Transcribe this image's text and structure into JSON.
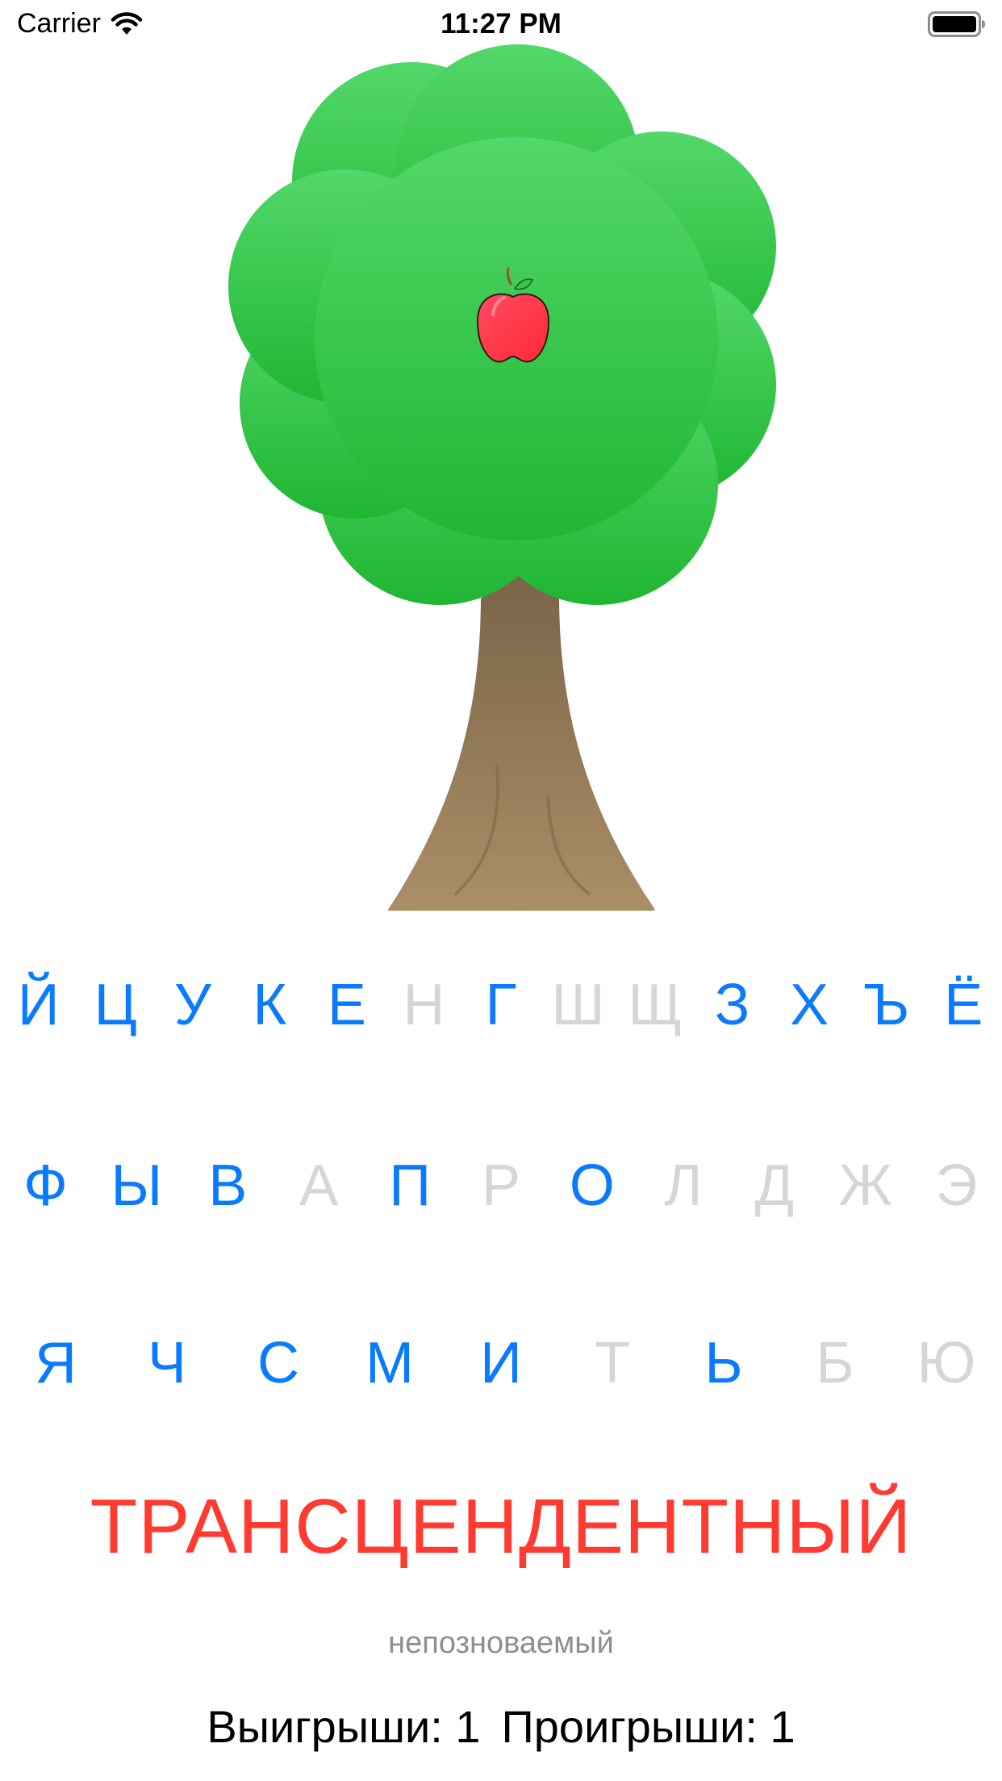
{
  "status_bar": {
    "carrier": "Carrier",
    "time": "11:27 PM",
    "wifi_icon": "wifi-icon",
    "battery_icon": "battery-full-icon"
  },
  "tree": {
    "apples_remaining": 1,
    "crown_color_top": "#53d86a",
    "crown_color_bottom": "#1fb632",
    "trunk_color_top": "#7a6447",
    "trunk_color_bottom": "#aa8f67",
    "apple_color": "#ff3347"
  },
  "keyboard": {
    "active_color": "#0a7aff",
    "disabled_color": "#d6d6d6",
    "rows": [
      [
        {
          "label": "Й",
          "enabled": true
        },
        {
          "label": "Ц",
          "enabled": true
        },
        {
          "label": "У",
          "enabled": true
        },
        {
          "label": "К",
          "enabled": true
        },
        {
          "label": "Е",
          "enabled": true
        },
        {
          "label": "Н",
          "enabled": false
        },
        {
          "label": "Г",
          "enabled": true
        },
        {
          "label": "Ш",
          "enabled": false
        },
        {
          "label": "Щ",
          "enabled": false
        },
        {
          "label": "З",
          "enabled": true
        },
        {
          "label": "Х",
          "enabled": true
        },
        {
          "label": "Ъ",
          "enabled": true
        },
        {
          "label": "Ё",
          "enabled": true
        }
      ],
      [
        {
          "label": "Ф",
          "enabled": true
        },
        {
          "label": "Ы",
          "enabled": true
        },
        {
          "label": "В",
          "enabled": true
        },
        {
          "label": "А",
          "enabled": false
        },
        {
          "label": "П",
          "enabled": true
        },
        {
          "label": "Р",
          "enabled": false
        },
        {
          "label": "О",
          "enabled": true
        },
        {
          "label": "Л",
          "enabled": false
        },
        {
          "label": "Д",
          "enabled": false
        },
        {
          "label": "Ж",
          "enabled": false
        },
        {
          "label": "Э",
          "enabled": false
        }
      ],
      [
        {
          "label": "Я",
          "enabled": true
        },
        {
          "label": "Ч",
          "enabled": true
        },
        {
          "label": "С",
          "enabled": true
        },
        {
          "label": "М",
          "enabled": true
        },
        {
          "label": "И",
          "enabled": true
        },
        {
          "label": "Т",
          "enabled": false
        },
        {
          "label": "Ь",
          "enabled": true
        },
        {
          "label": "Б",
          "enabled": false
        },
        {
          "label": "Ю",
          "enabled": false
        }
      ]
    ]
  },
  "game": {
    "answer_word": "ТРАНСЦЕНДЕНТНЫЙ",
    "answer_color": "#ff3b30",
    "guessed_word": "непозноваемый",
    "wins_text": "Выигрыши: 1",
    "losses_text": "Проигрыши: 1"
  }
}
